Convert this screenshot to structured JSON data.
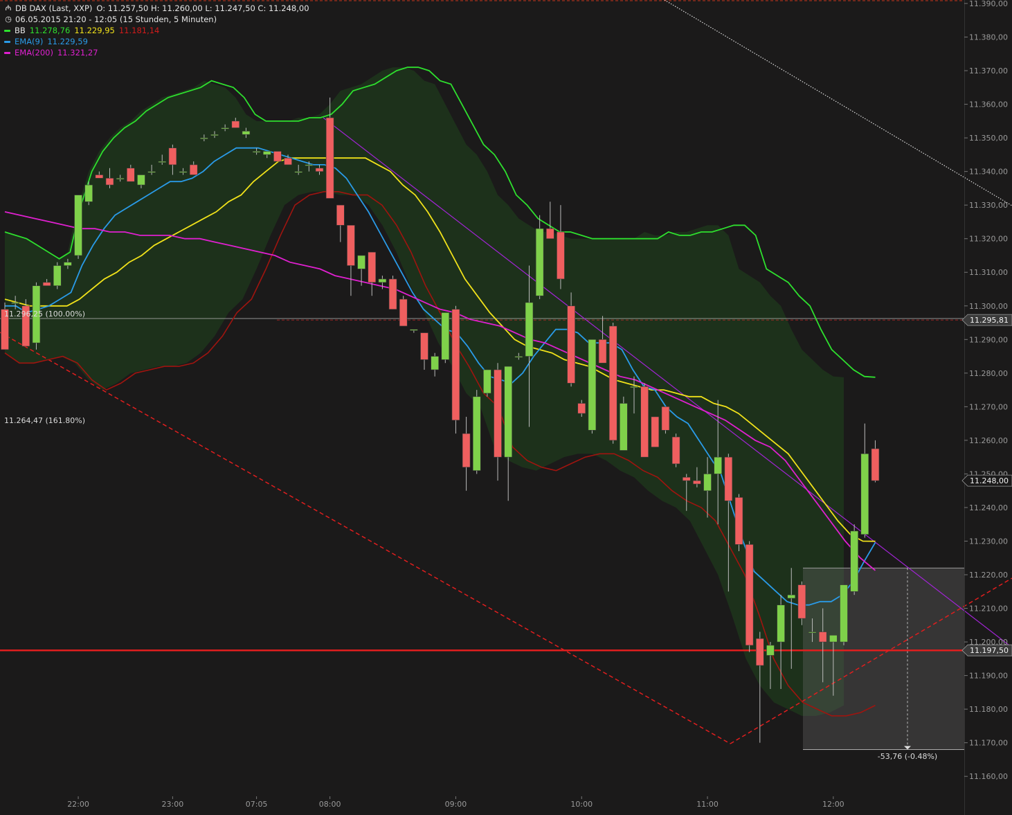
{
  "header": {
    "symbol": "DB DAX (Last, XXP)",
    "ohlc": "O: 11.257,50  H: 11.260,00  L: 11.247,50  C: 11.248,00",
    "period": "06.05.2015 21:20 - 12:05 (15 Stunden, 5 Minuten)",
    "indicators": [
      {
        "name": "BB",
        "values": [
          "11.278,76",
          "11.229,95",
          "11.181,14"
        ],
        "colors": [
          "#2ee02e",
          "#f1e21a",
          "#d11b1b"
        ]
      },
      {
        "name": "EMA(9)",
        "values": [
          "11.229,59"
        ],
        "colors": [
          "#2a9be8"
        ]
      },
      {
        "name": "EMA(200)",
        "values": [
          "11.321,27"
        ],
        "colors": [
          "#e020d0"
        ]
      }
    ]
  },
  "annotations": {
    "fib_100": "11.296,25 (100.00%)",
    "fib_161": "11.264,47 (161.80%)",
    "measure": "-53,76 (-0.48%)"
  },
  "price_tags": [
    {
      "label": "11.295,81",
      "value": 11295.81,
      "bg": "#3a3a3a"
    },
    {
      "label": "11.248,00",
      "value": 11248.0,
      "bg": "#1b1a1a"
    },
    {
      "label": "11.197,50",
      "value": 11197.5,
      "bg": "#3a3a3a"
    }
  ],
  "chart_data": {
    "type": "candlestick",
    "y_ticks": [
      "11.390,00",
      "11.380,00",
      "11.370,00",
      "11.360,00",
      "11.350,00",
      "11.340,00",
      "11.330,00",
      "11.320,00",
      "11.310,00",
      "11.300,00",
      "11.290,00",
      "11.280,00",
      "11.270,00",
      "11.260,00",
      "11.250,00",
      "11.240,00",
      "11.230,00",
      "11.220,00",
      "11.210,00",
      "11.200,00",
      "11.190,00",
      "11.180,00",
      "11.170,00",
      "11.160,00"
    ],
    "ylim": [
      11155,
      11393
    ],
    "x_ticks": [
      {
        "label": "22:00",
        "bar": 7
      },
      {
        "label": "23:00",
        "bar": 16
      },
      {
        "label": "07:05",
        "bar": 24
      },
      {
        "label": "08:00",
        "bar": 31
      },
      {
        "label": "09:00",
        "bar": 43
      },
      {
        "label": "10:00",
        "bar": 55
      },
      {
        "label": "11:00",
        "bar": 67
      },
      {
        "label": "12:00",
        "bar": 79
      }
    ],
    "candles": [
      {
        "o": 11299,
        "h": 11301,
        "l": 11287,
        "c": 11287
      },
      {
        "o": 11301,
        "h": 11303,
        "l": 11299,
        "c": 11301
      },
      {
        "o": 11300,
        "h": 11302,
        "l": 11288,
        "c": 11288
      },
      {
        "o": 11289,
        "h": 11307,
        "l": 11287,
        "c": 11306
      },
      {
        "o": 11307,
        "h": 11308,
        "l": 11306,
        "c": 11306
      },
      {
        "o": 11306,
        "h": 11313,
        "l": 11305,
        "c": 11312
      },
      {
        "o": 11312,
        "h": 11314,
        "l": 11311,
        "c": 11313
      },
      {
        "o": 11315,
        "h": 11333,
        "l": 11314,
        "c": 11333
      },
      {
        "o": 11331,
        "h": 11337,
        "l": 11330,
        "c": 11336
      },
      {
        "o": 11339,
        "h": 11340,
        "l": 11338,
        "c": 11338
      },
      {
        "o": 11338,
        "h": 11341,
        "l": 11335,
        "c": 11336
      },
      {
        "o": 11338,
        "h": 11339,
        "l": 11337,
        "c": 11338
      },
      {
        "o": 11341,
        "h": 11342,
        "l": 11337,
        "c": 11337
      },
      {
        "o": 11336,
        "h": 11339,
        "l": 11335,
        "c": 11339
      },
      {
        "o": 11340,
        "h": 11342,
        "l": 11339,
        "c": 11340
      },
      {
        "o": 11343,
        "h": 11345,
        "l": 11342,
        "c": 11343
      },
      {
        "o": 11347,
        "h": 11348,
        "l": 11339,
        "c": 11342
      },
      {
        "o": 11340,
        "h": 11341,
        "l": 11339,
        "c": 11340
      },
      {
        "o": 11342,
        "h": 11343,
        "l": 11339,
        "c": 11339
      },
      {
        "o": 11350,
        "h": 11351,
        "l": 11349,
        "c": 11350
      },
      {
        "o": 11351,
        "h": 11352,
        "l": 11350,
        "c": 11351
      },
      {
        "o": 11353,
        "h": 11354,
        "l": 11352,
        "c": 11353
      },
      {
        "o": 11355,
        "h": 11356,
        "l": 11353,
        "c": 11353
      },
      {
        "o": 11351,
        "h": 11353,
        "l": 11350,
        "c": 11352
      },
      {
        "o": 11346,
        "h": 11347,
        "l": 11345,
        "c": 11346
      },
      {
        "o": 11345,
        "h": 11346,
        "l": 11344,
        "c": 11346
      },
      {
        "o": 11346,
        "h": 11346,
        "l": 11343,
        "c": 11343
      },
      {
        "o": 11344,
        "h": 11345,
        "l": 11342,
        "c": 11342
      },
      {
        "o": 11340,
        "h": 11342,
        "l": 11339,
        "c": 11340
      },
      {
        "o": 11342,
        "h": 11343,
        "l": 11340,
        "c": 11342
      },
      {
        "o": 11341,
        "h": 11342,
        "l": 11339,
        "c": 11340
      },
      {
        "o": 11356,
        "h": 11362,
        "l": 11333,
        "c": 11332
      },
      {
        "o": 11330,
        "h": 11330,
        "l": 11319,
        "c": 11324
      },
      {
        "o": 11324,
        "h": 11324,
        "l": 11303,
        "c": 11312
      },
      {
        "o": 11311,
        "h": 11315,
        "l": 11306,
        "c": 11315
      },
      {
        "o": 11316,
        "h": 11316,
        "l": 11303,
        "c": 11307
      },
      {
        "o": 11307,
        "h": 11309,
        "l": 11305,
        "c": 11308
      },
      {
        "o": 11308,
        "h": 11309,
        "l": 11299,
        "c": 11299
      },
      {
        "o": 11302,
        "h": 11303,
        "l": 11294,
        "c": 11294
      },
      {
        "o": 11293,
        "h": 11293,
        "l": 11292,
        "c": 11293
      },
      {
        "o": 11292,
        "h": 11292,
        "l": 11281,
        "c": 11284
      },
      {
        "o": 11281,
        "h": 11286,
        "l": 11279,
        "c": 11285
      },
      {
        "o": 11284,
        "h": 11298,
        "l": 11283,
        "c": 11298
      },
      {
        "o": 11299,
        "h": 11300,
        "l": 11262,
        "c": 11266
      },
      {
        "o": 11262,
        "h": 11267,
        "l": 11245,
        "c": 11252
      },
      {
        "o": 11251,
        "h": 11275,
        "l": 11250,
        "c": 11273
      },
      {
        "o": 11274,
        "h": 11281,
        "l": 11273,
        "c": 11281
      },
      {
        "o": 11281,
        "h": 11283,
        "l": 11248,
        "c": 11255
      },
      {
        "o": 11255,
        "h": 11282,
        "l": 11242,
        "c": 11282
      },
      {
        "o": 11285,
        "h": 11286,
        "l": 11284,
        "c": 11285
      },
      {
        "o": 11285,
        "h": 11312,
        "l": 11264,
        "c": 11301
      },
      {
        "o": 11303,
        "h": 11327,
        "l": 11302,
        "c": 11323
      },
      {
        "o": 11323,
        "h": 11331,
        "l": 11322,
        "c": 11320
      },
      {
        "o": 11322,
        "h": 11330,
        "l": 11305,
        "c": 11308
      },
      {
        "o": 11300,
        "h": 11304,
        "l": 11276,
        "c": 11277
      },
      {
        "o": 11271,
        "h": 11272,
        "l": 11267,
        "c": 11268
      },
      {
        "o": 11263,
        "h": 11290,
        "l": 11262,
        "c": 11290
      },
      {
        "o": 11290,
        "h": 11297,
        "l": 11283,
        "c": 11283
      },
      {
        "o": 11294,
        "h": 11295,
        "l": 11259,
        "c": 11260
      },
      {
        "o": 11257,
        "h": 11273,
        "l": 11257,
        "c": 11271
      },
      {
        "o": 11276,
        "h": 11279,
        "l": 11268,
        "c": 11276
      },
      {
        "o": 11276,
        "h": 11277,
        "l": 11255,
        "c": 11255
      },
      {
        "o": 11267,
        "h": 11267,
        "l": 11258,
        "c": 11258
      },
      {
        "o": 11270,
        "h": 11270,
        "l": 11262,
        "c": 11263
      },
      {
        "o": 11261,
        "h": 11262,
        "l": 11252,
        "c": 11253
      },
      {
        "o": 11249,
        "h": 11250,
        "l": 11239,
        "c": 11248
      },
      {
        "o": 11248,
        "h": 11252,
        "l": 11246,
        "c": 11247
      },
      {
        "o": 11245,
        "h": 11255,
        "l": 11237,
        "c": 11250
      },
      {
        "o": 11250,
        "h": 11272,
        "l": 11235,
        "c": 11255
      },
      {
        "o": 11255,
        "h": 11256,
        "l": 11215,
        "c": 11242
      },
      {
        "o": 11243,
        "h": 11244,
        "l": 11227,
        "c": 11229
      },
      {
        "o": 11229,
        "h": 11230,
        "l": 11197,
        "c": 11199
      },
      {
        "o": 11201,
        "h": 11203,
        "l": 11170,
        "c": 11193
      },
      {
        "o": 11196,
        "h": 11200,
        "l": 11186,
        "c": 11199
      },
      {
        "o": 11200,
        "h": 11214,
        "l": 11186,
        "c": 11211
      },
      {
        "o": 11213,
        "h": 11222,
        "l": 11192,
        "c": 11214
      },
      {
        "o": 11217,
        "h": 11218,
        "l": 11205,
        "c": 11207
      },
      {
        "o": 11203,
        "h": 11207,
        "l": 11200,
        "c": 11203
      },
      {
        "o": 11203,
        "h": 11210,
        "l": 11188,
        "c": 11200
      },
      {
        "o": 11200,
        "h": 11202,
        "l": 11184,
        "c": 11202
      },
      {
        "o": 11200,
        "h": 11217,
        "l": 11199,
        "c": 11217
      },
      {
        "o": 11215,
        "h": 11235,
        "l": 11214,
        "c": 11233
      },
      {
        "o": 11232,
        "h": 11265,
        "l": 11231,
        "c": 11256
      },
      {
        "o": 11257.5,
        "h": 11260,
        "l": 11247.5,
        "c": 11248
      }
    ],
    "series": [
      {
        "name": "BB",
        "color": "#2ee02e",
        "values": [
          11322,
          11321,
          11320,
          11318,
          11316,
          11314,
          11316,
          11330,
          11340,
          11346,
          11350,
          11353,
          11355,
          11358,
          11360,
          11362,
          11363,
          11364,
          11365,
          11367,
          11366,
          11365,
          11362,
          11357,
          11355,
          11355,
          11355,
          11355,
          11356,
          11356,
          11357,
          11360,
          11364,
          11365,
          11366,
          11368,
          11370,
          11371,
          11371,
          11370,
          11367,
          11366,
          11360,
          11354,
          11348,
          11345,
          11340,
          11333,
          11330,
          11326,
          11324,
          11322,
          11322,
          11321,
          11320,
          11320,
          11320,
          11320,
          11320,
          11320,
          11320,
          11322,
          11321,
          11321,
          11322,
          11322,
          11323,
          11324,
          11324,
          11321,
          11311,
          11309,
          11307,
          11303,
          11300,
          11293,
          11287,
          11284,
          11281,
          11279,
          11278.76
        ]
      },
      {
        "name": "BB mid",
        "color": "#f1e21a",
        "values": [
          11302,
          11301,
          11300,
          11300,
          11300,
          11300,
          11302,
          11305,
          11308,
          11310,
          11313,
          11315,
          11318,
          11320,
          11322,
          11324,
          11326,
          11328,
          11331,
          11333,
          11337,
          11340,
          11343,
          11344,
          11344,
          11344,
          11344,
          11344,
          11344,
          11344,
          11342,
          11340,
          11336,
          11333,
          11328,
          11322,
          11315,
          11308,
          11303,
          11298,
          11294,
          11290,
          11288,
          11287,
          11286,
          11284,
          11283,
          11282,
          11280,
          11278,
          11277,
          11276,
          11275,
          11275,
          11274,
          11273,
          11273,
          11271,
          11270,
          11268,
          11265,
          11262,
          11259,
          11256,
          11251,
          11246,
          11241,
          11236,
          11232,
          11230,
          11229.95
        ]
      },
      {
        "name": "BB low",
        "color": "#a0140f",
        "values": [
          11286,
          11283,
          11283,
          11284,
          11285,
          11283,
          11278,
          11275,
          11277,
          11280,
          11281,
          11282,
          11282,
          11283,
          11286,
          11291,
          11298,
          11302,
          11311,
          11321,
          11330,
          11333,
          11334,
          11334,
          11333,
          11333,
          11330,
          11324,
          11316,
          11306,
          11298,
          11289,
          11282,
          11274,
          11270,
          11258,
          11254,
          11252,
          11251,
          11253,
          11255,
          11256,
          11256,
          11254,
          11251,
          11249,
          11245,
          11242,
          11240,
          11236,
          11228,
          11220,
          11208,
          11195,
          11187,
          11182,
          11180,
          11178,
          11178,
          11179,
          11181.14
        ]
      },
      {
        "name": "EMA9",
        "color": "#2a9be8",
        "values": [
          11300,
          11300,
          11298,
          11299,
          11300,
          11302,
          11304,
          11312,
          11318,
          11323,
          11327,
          11329,
          11331,
          11333,
          11335,
          11337,
          11337,
          11338,
          11340,
          11343,
          11345,
          11347,
          11347,
          11347,
          11346,
          11345,
          11344,
          11343,
          11342,
          11342,
          11341,
          11338,
          11333,
          11328,
          11322,
          11316,
          11310,
          11304,
          11299,
          11296,
          11293,
          11292,
          11288,
          11283,
          11279,
          11278,
          11277,
          11280,
          11285,
          11289,
          11293,
          11293,
          11292,
          11289,
          11289,
          11289,
          11287,
          11281,
          11276,
          11275,
          11270,
          11267,
          11265,
          11260,
          11255,
          11250,
          11240,
          11230,
          11221,
          11218,
          11215,
          11212,
          11211,
          11211,
          11212,
          11212,
          11214,
          11218,
          11224,
          11229.59
        ]
      },
      {
        "name": "EMA200",
        "color": "#e020d0",
        "values": [
          11328,
          11327,
          11326,
          11325,
          11324,
          11323,
          11323,
          11322,
          11322,
          11321,
          11321,
          11321,
          11320,
          11320,
          11319,
          11318,
          11317,
          11316,
          11315,
          11313,
          11312,
          11311,
          11309,
          11308,
          11307,
          11306,
          11305,
          11303,
          11301,
          11299,
          11298,
          11296,
          11295,
          11294,
          11292,
          11290,
          11289,
          11287,
          11285,
          11283,
          11281,
          11279,
          11278,
          11276,
          11274,
          11272,
          11270,
          11268,
          11266,
          11263,
          11260,
          11258,
          11254,
          11248,
          11242,
          11236,
          11230,
          11225,
          11221.27
        ]
      }
    ]
  }
}
